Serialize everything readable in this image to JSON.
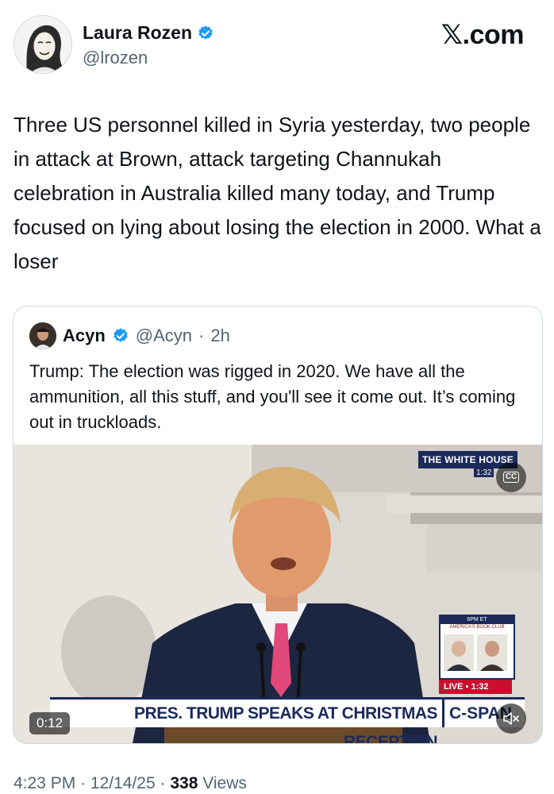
{
  "post": {
    "author_name": "Laura Rozen",
    "author_handle": "@lrozen",
    "brand_x": "𝕏",
    "brand_suffix": ".com",
    "text": "Three US personnel killed in Syria yesterday, two people in attack at Brown, attack targeting Channukah celebration in Australia killed many today, and Trump focused on lying about losing the election in 2000. What a loser",
    "time": "4:23 PM",
    "date": "12/14/25",
    "separator": "·",
    "views_count": "338",
    "views_label": "Views"
  },
  "quote": {
    "author_name": "Acyn",
    "author_handle": "@Acyn",
    "separator": "·",
    "age": "2h",
    "text": "Trump: The election was rigged in 2020. We have all the ammunition, all this stuff, and you'll see it come out. It’s coming out in truckloads.",
    "video": {
      "network_bug": "THE WHITE HOUSE",
      "network_time": "1:32",
      "cc_label": "CC",
      "book_box_top": "6PM ET",
      "book_box_title": "AMERICA'S BOOK CLUB",
      "live_label": "LIVE",
      "live_time": "1:32",
      "chyron": "PRES. TRUMP SPEAKS AT CHRISTMAS RECEPTION",
      "channel": "C-SPAN",
      "duration": "0:12"
    }
  },
  "colors": {
    "verified_blue": "#1d9bf0",
    "text_primary": "#0f1419",
    "text_secondary": "#536471",
    "cspan_navy": "#1b2a5a",
    "live_red": "#c8102e"
  },
  "icons": {
    "verified": "verified-badge-icon",
    "cc": "closed-captions-icon",
    "mute": "speaker-muted-icon"
  }
}
